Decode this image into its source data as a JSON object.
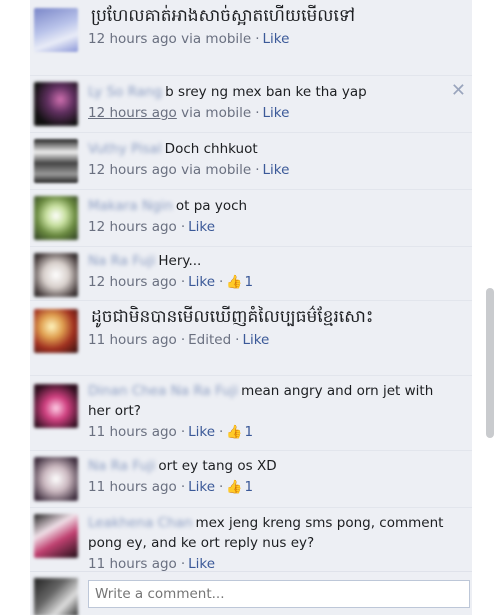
{
  "comments": [
    {
      "name": "",
      "text": "ប្រហែលគាត់អាងសាច់ស្អាតហើយមើលទៅ",
      "timestamp": "12 hours ago",
      "via": "via mobile",
      "action": "Like"
    },
    {
      "name": "Ly So Rang",
      "text": "b srey ng mex ban ke tha yap",
      "timestamp": "12 hours ago",
      "via": "via mobile",
      "action": "Like"
    },
    {
      "name": "Vuthy Pisal",
      "text": "Doch chhkuot",
      "timestamp": "12 hours ago",
      "via": "via mobile",
      "action": "Like"
    },
    {
      "name": "Makara Ngin",
      "text": "ot pa yoch",
      "timestamp": "12 hours ago",
      "action": "Like"
    },
    {
      "name": "Na Ra Fuji",
      "text": "Hery...",
      "timestamp": "12 hours ago",
      "action": "Like",
      "likes": "1"
    },
    {
      "name": "",
      "text": "ដូចជាមិនបានមើលឃើញគំលៃប្បធម៌ខ្មែរសោះ",
      "timestamp": "11 hours ago",
      "edited": "Edited",
      "action": "Like"
    },
    {
      "name": "Dinan Chea Na Ra Fuji",
      "text": "mean angry and orn jet with her ort?",
      "timestamp": "11 hours ago",
      "action": "Like",
      "likes": "1"
    },
    {
      "name": "Na Ra Fuji",
      "text": "ort ey tang os XD",
      "timestamp": "11 hours ago",
      "action": "Like",
      "likes": "1"
    },
    {
      "name": "Leakhena Chan",
      "text": "mex jeng kreng sms pong, comment pong ey, and ke ort reply nus ey?",
      "timestamp": "11 hours ago",
      "action": "Like"
    }
  ],
  "composer": {
    "placeholder": "Write a comment..."
  },
  "icons": {
    "close": "close-icon",
    "like": "thumbs-up-icon"
  },
  "colors": {
    "link": "#3b5998",
    "panel_bg": "#edeff4",
    "meta_text": "#6a7080"
  }
}
